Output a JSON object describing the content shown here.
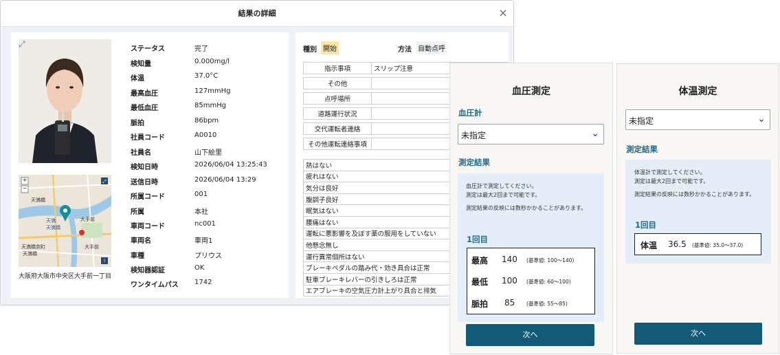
{
  "dialog": {
    "title": "結果の詳細",
    "close_label": "×"
  },
  "location": {
    "address": "大阪府大阪市中央区大手前一丁目",
    "map_labels": [
      "天満橋",
      "天満",
      "天満橋",
      "大手前",
      "天満橋京町",
      "天満橋",
      "大手前"
    ]
  },
  "details": [
    {
      "label": "ステータス",
      "value": "完了"
    },
    {
      "label": "検知量",
      "value": "0.000mg/l"
    },
    {
      "label": "体温",
      "value": "37.0°C"
    },
    {
      "label": "最高血圧",
      "value": "127mmHg"
    },
    {
      "label": "最低血圧",
      "value": "85mmHg"
    },
    {
      "label": "脈拍",
      "value": "86bpm"
    },
    {
      "label": "社員コード",
      "value": "A0010"
    },
    {
      "label": "社員名",
      "value": "山下絵里"
    },
    {
      "label": "検知日時",
      "value": "2026/06/04 13:25:43"
    },
    {
      "label": "送信日時",
      "value": "2026/06/04 13:29"
    },
    {
      "label": "所属コード",
      "value": "001"
    },
    {
      "label": "所属",
      "value": "本社"
    },
    {
      "label": "車両コード",
      "value": "nc001"
    },
    {
      "label": "車両名",
      "value": "車両1"
    },
    {
      "label": "車種",
      "value": "プリウス"
    },
    {
      "label": "検知器認証",
      "value": "OK"
    },
    {
      "label": "ワンタイムパス",
      "value": "1742"
    }
  ],
  "right": {
    "type_label": "種別",
    "type_value": "開始",
    "method_label": "方法",
    "method_value": "自動点呼",
    "info_rows": [
      {
        "key": "指示事項",
        "value": "スリップ注意"
      },
      {
        "key": "その他",
        "value": ""
      },
      {
        "key": "点呼場所",
        "value": ""
      },
      {
        "key": "道路運行状況",
        "value": ""
      },
      {
        "key": "交代運転者連絡",
        "value": ""
      },
      {
        "key": "その他運転連絡事項",
        "value": ""
      }
    ],
    "checks": [
      "熱はない",
      "疲れはない",
      "気分は良好",
      "腹調子良好",
      "眠気はない",
      "腰痛はない",
      "運転に悪影響を及ぼす薬の服用をしていない",
      "他懸念無し",
      "運行異常個所はない",
      "ブレーキペダルの踏み代・効き具合は正常",
      "駐車ブレーキレバーの引きしろは正常",
      "エアブレーキの空気圧力計上がり具合と排気"
    ]
  },
  "bp_panel": {
    "title": "血圧測定",
    "device_label": "血圧計",
    "select_value": "未指定",
    "result_label": "測定結果",
    "note1": "血圧計で測定してください。",
    "note2": "測定は最大2回まで可能です。",
    "note3": "測定結果の反映には数秒かかることがあります。",
    "count": "1回目",
    "rows": [
      {
        "label": "最高",
        "value": "140",
        "range": "(基準値: 100〜140)"
      },
      {
        "label": "最低",
        "value": "100",
        "range": "(基準値: 60〜100)"
      },
      {
        "label": "脈拍",
        "value": "85",
        "range": "(基準値: 55〜85)"
      }
    ],
    "next_label": "次へ"
  },
  "temp_panel": {
    "title": "体温測定",
    "select_value": "未指定",
    "result_label": "測定結果",
    "note1": "体温計で測定してください。",
    "note2": "測定は最大2回まで可能です。",
    "note3": "測定結果の反映には数秒かかることがあります。",
    "count": "1回目",
    "row": {
      "label": "体温",
      "value": "36.5",
      "range": "(基準値: 35.0〜37.0)"
    },
    "next_label": "次へ"
  }
}
